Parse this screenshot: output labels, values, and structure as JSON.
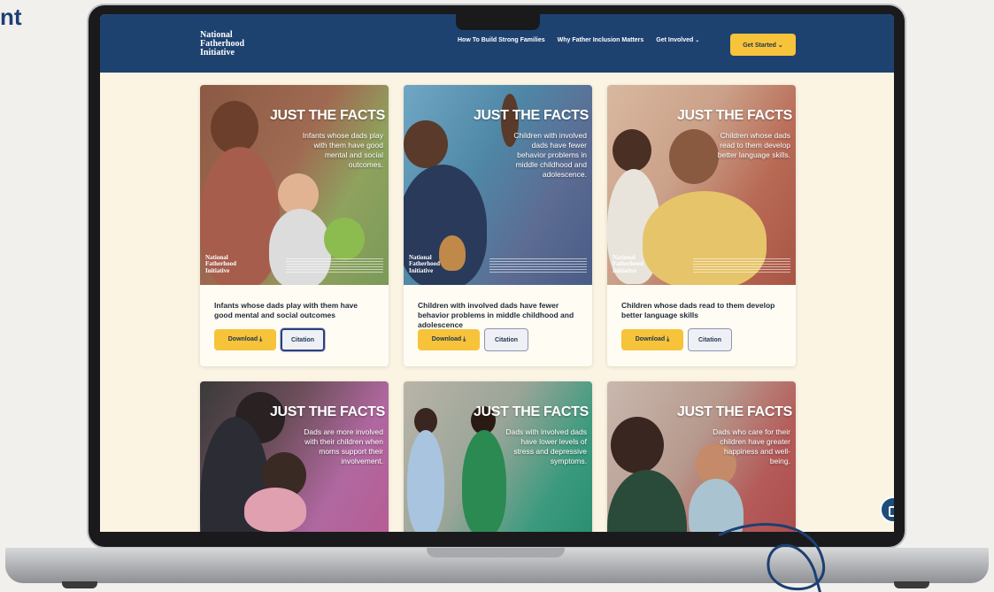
{
  "corner_text": "nt",
  "site": {
    "logo_lines": [
      "National",
      "Fatherhood",
      "Initiative"
    ],
    "nav": [
      {
        "label": "How To Build Strong Families"
      },
      {
        "label": "Why Father Inclusion Matters"
      },
      {
        "label": "Get Involved"
      }
    ],
    "cta_label": "Get Started",
    "chevron": "⌄"
  },
  "cards": [
    {
      "heading": "JUST THE FACTS",
      "image_text": "Infants whose dads play with them have good mental and social outcomes.",
      "caption": "Infants whose dads play with them have good mental and social outcomes",
      "download_label": "Download",
      "citation_label": "Citation",
      "bg": "#6e8a52"
    },
    {
      "heading": "JUST THE FACTS",
      "image_text": "Children with involved dads have fewer behavior problems in middle childhood and adolescence.",
      "caption": "Children with involved dads have fewer behavior problems in middle childhood and adolescence",
      "download_label": "Download",
      "citation_label": "Citation",
      "bg": "#4f5f87"
    },
    {
      "heading": "JUST THE FACTS",
      "image_text": "Children whose dads read to them develop better language skills.",
      "caption": "Children whose dads read to them develop better language skills",
      "download_label": "Download",
      "citation_label": "Citation",
      "bg": "#b36050"
    },
    {
      "heading": "JUST THE FACTS",
      "image_text": "Dads are more involved with their children when moms support their involvement.",
      "bg": "#b05a8c"
    },
    {
      "heading": "JUST THE FACTS",
      "image_text": "Dads with involved dads have lower levels of stress and depressive symptoms.",
      "bg": "#2f8a72"
    },
    {
      "heading": "JUST THE FACTS",
      "image_text": "Dads who care for their children have greater happiness and well-being.",
      "bg": "#b24a48"
    }
  ],
  "image_logo_lines": [
    "National",
    "Fatherhood",
    "Initiative"
  ],
  "icons": {
    "download": "download-icon",
    "chat": "chat-icon"
  },
  "colors": {
    "header": "#1e4270",
    "accent": "#f6c33b",
    "page_bg": "#fbf4e3"
  }
}
